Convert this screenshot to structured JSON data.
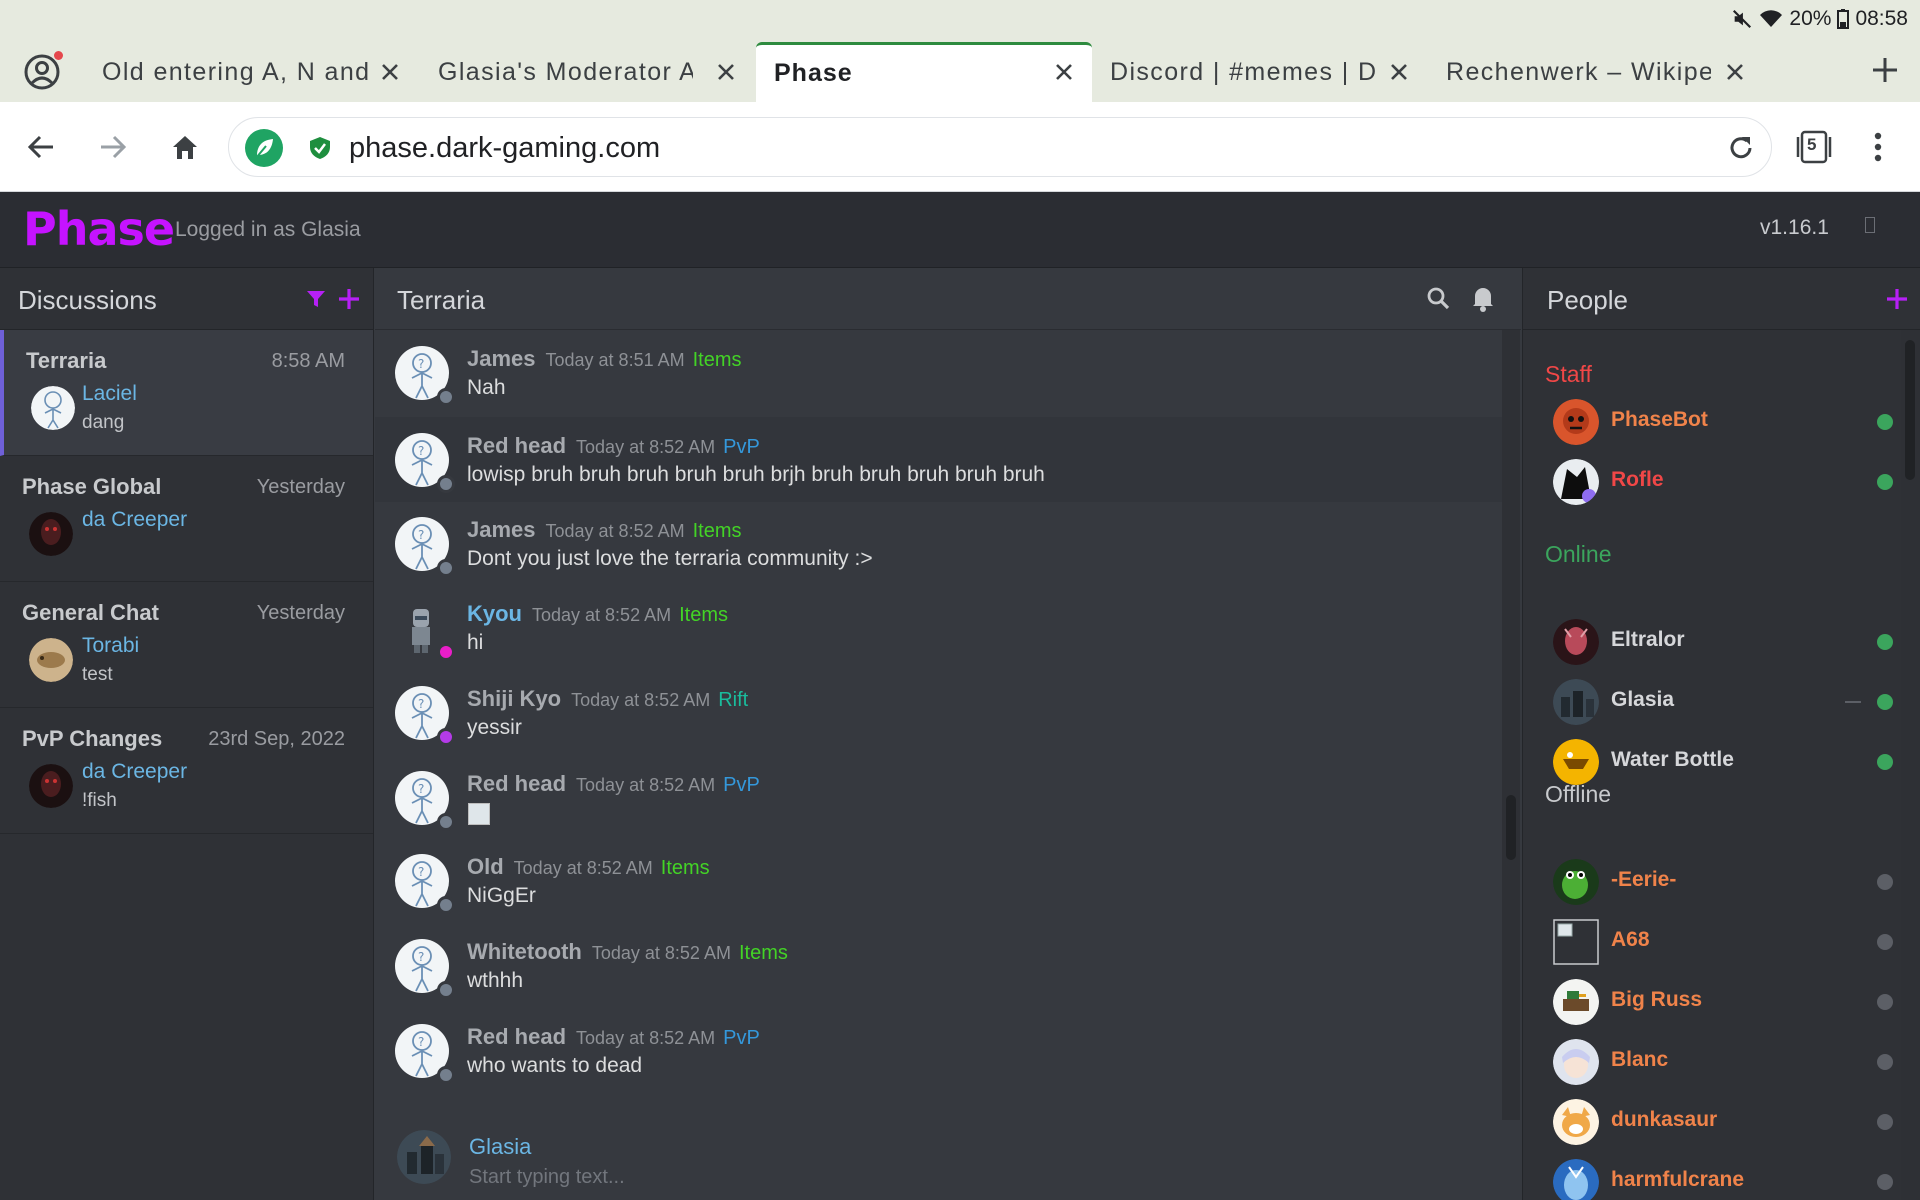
{
  "status_bar": {
    "battery": "20%",
    "clock": "08:58"
  },
  "tabs": [
    {
      "title": "Old entering A, N and",
      "active": false
    },
    {
      "title": "Glasia's Moderator A",
      "active": false
    },
    {
      "title": "Phase",
      "active": true
    },
    {
      "title": "Discord | #memes | D",
      "active": false
    },
    {
      "title": "Rechenwerk – Wikipe",
      "active": false
    }
  ],
  "address_bar": {
    "url": "phase.dark-gaming.com",
    "tab_count": "5"
  },
  "app": {
    "logo": "Phase",
    "logged_in": "Logged in as Glasia",
    "version": "v1.16.1"
  },
  "discussions": {
    "title": "Discussions",
    "items": [
      {
        "name": "Terraria",
        "time": "8:58 AM",
        "user": "Laciel",
        "message": "dang",
        "active": true
      },
      {
        "name": "Phase Global",
        "time": "Yesterday",
        "user": "da Creeper",
        "message": "",
        "active": false
      },
      {
        "name": "General Chat",
        "time": "Yesterday",
        "user": "Torabi",
        "message": "test",
        "active": false
      },
      {
        "name": "PvP Changes",
        "time": "23rd Sep, 2022",
        "user": "da Creeper",
        "message": "!fish",
        "active": false
      }
    ]
  },
  "chat": {
    "title": "Terraria",
    "messages": [
      {
        "user": "James",
        "time": "Today at 8:51 AM",
        "tag": "Items",
        "tag_color": "#43d326",
        "text": "Nah",
        "status_color": "#747f8d"
      },
      {
        "user": "Red head",
        "time": "Today at 8:52 AM",
        "tag": "PvP",
        "tag_color": "#3498db",
        "text": "lowisp bruh bruh bruh bruh bruh brjh bruh bruh bruh bruh bruh",
        "status_color": "#747f8d"
      },
      {
        "user": "James",
        "time": "Today at 8:52 AM",
        "tag": "Items",
        "tag_color": "#43d326",
        "text": "Dont you just love the terraria community :>",
        "status_color": "#747f8d"
      },
      {
        "user": "Kyou",
        "time": "Today at 8:52 AM",
        "tag": "Items",
        "tag_color": "#43d326",
        "text": "hi",
        "status_color": "#e91ec8"
      },
      {
        "user": "Shiji Kyo",
        "time": "Today at 8:52 AM",
        "tag": "Rift",
        "tag_color": "#1abc9c",
        "text": "yessir",
        "status_color": "#b43be8"
      },
      {
        "user": "Red head",
        "time": "Today at 8:52 AM",
        "tag": "PvP",
        "tag_color": "#3498db",
        "text": "",
        "status_color": "#747f8d"
      },
      {
        "user": "Old",
        "time": "Today at 8:52 AM",
        "tag": "Items",
        "tag_color": "#43d326",
        "text": "NiGgEr",
        "status_color": "#747f8d"
      },
      {
        "user": "Whitetooth",
        "time": "Today at 8:52 AM",
        "tag": "Items",
        "tag_color": "#43d326",
        "text": "wthhh",
        "status_color": "#747f8d"
      },
      {
        "user": "Red head",
        "time": "Today at 8:52 AM",
        "tag": "PvP",
        "tag_color": "#3498db",
        "text": "who wants to dead",
        "status_color": "#747f8d"
      }
    ],
    "composer": {
      "user": "Glasia",
      "placeholder": "Start typing text..."
    }
  },
  "people": {
    "title": "People",
    "groups": [
      {
        "label": "Staff",
        "color": "#f04747",
        "members": [
          {
            "name": "PhaseBot",
            "color": "#f0834a",
            "status": "#3ba55d"
          },
          {
            "name": "Rofle",
            "color": "#f04747",
            "status": "#3ba55d"
          }
        ]
      },
      {
        "label": "Online",
        "color": "#3ba55d",
        "members": [
          {
            "name": "Eltralor",
            "color": "#d6d7da",
            "status": "#3ba55d"
          },
          {
            "name": "Glasia",
            "color": "#d6d7da",
            "status": "#3ba55d"
          },
          {
            "name": "Water Bottle",
            "color": "#d6d7da",
            "status": "#3ba55d"
          }
        ]
      },
      {
        "label": "Offline",
        "color": "#c8cacd",
        "members": [
          {
            "name": "-Eerie-",
            "color": "#f0834a",
            "status": "#5c5f66"
          },
          {
            "name": "A68",
            "color": "#f0834a",
            "status": "#5c5f66"
          },
          {
            "name": "Big Russ",
            "color": "#f0834a",
            "status": "#5c5f66"
          },
          {
            "name": "Blanc",
            "color": "#f0834a",
            "status": "#5c5f66"
          },
          {
            "name": "dunkasaur",
            "color": "#f0834a",
            "status": "#5c5f66"
          },
          {
            "name": "harmfulcrane",
            "color": "#f0834a",
            "status": "#5c5f66"
          }
        ]
      }
    ]
  }
}
